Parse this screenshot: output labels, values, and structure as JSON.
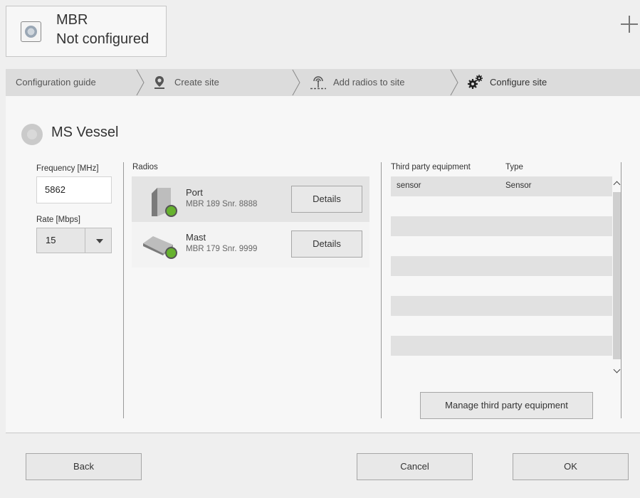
{
  "header": {
    "device_name": "MBR",
    "device_status": "Not configured"
  },
  "breadcrumb": {
    "items": [
      {
        "label": "Configuration guide",
        "icon": ""
      },
      {
        "label": "Create site",
        "icon": "map-pin-icon"
      },
      {
        "label": "Add radios to site",
        "icon": "antenna-icon"
      },
      {
        "label": "Configure site",
        "icon": "gears-icon"
      }
    ]
  },
  "site": {
    "name": "MS Vessel"
  },
  "frequency": {
    "label": "Frequency [MHz]",
    "value": "5862"
  },
  "rate": {
    "label": "Rate [Mbps]",
    "value": "15"
  },
  "radios": {
    "header": "Radios",
    "items": [
      {
        "name": "Port",
        "detail": "MBR 189 Snr. 8888",
        "button": "Details",
        "status_color": "#66b22e"
      },
      {
        "name": "Mast",
        "detail": "MBR 179 Snr. 9999",
        "button": "Details",
        "status_color": "#66b22e"
      }
    ]
  },
  "third_party": {
    "columns": [
      "Third party equipment",
      "Type"
    ],
    "rows": [
      {
        "name": "sensor",
        "type": "Sensor"
      }
    ],
    "manage_button": "Manage third party equipment"
  },
  "footer": {
    "back": "Back",
    "cancel": "Cancel",
    "ok": "OK"
  },
  "colors": {
    "status_ok": "#66b22e",
    "breadcrumb_bg": "#dcdcdc",
    "row_alt": "#e1e1e1"
  }
}
